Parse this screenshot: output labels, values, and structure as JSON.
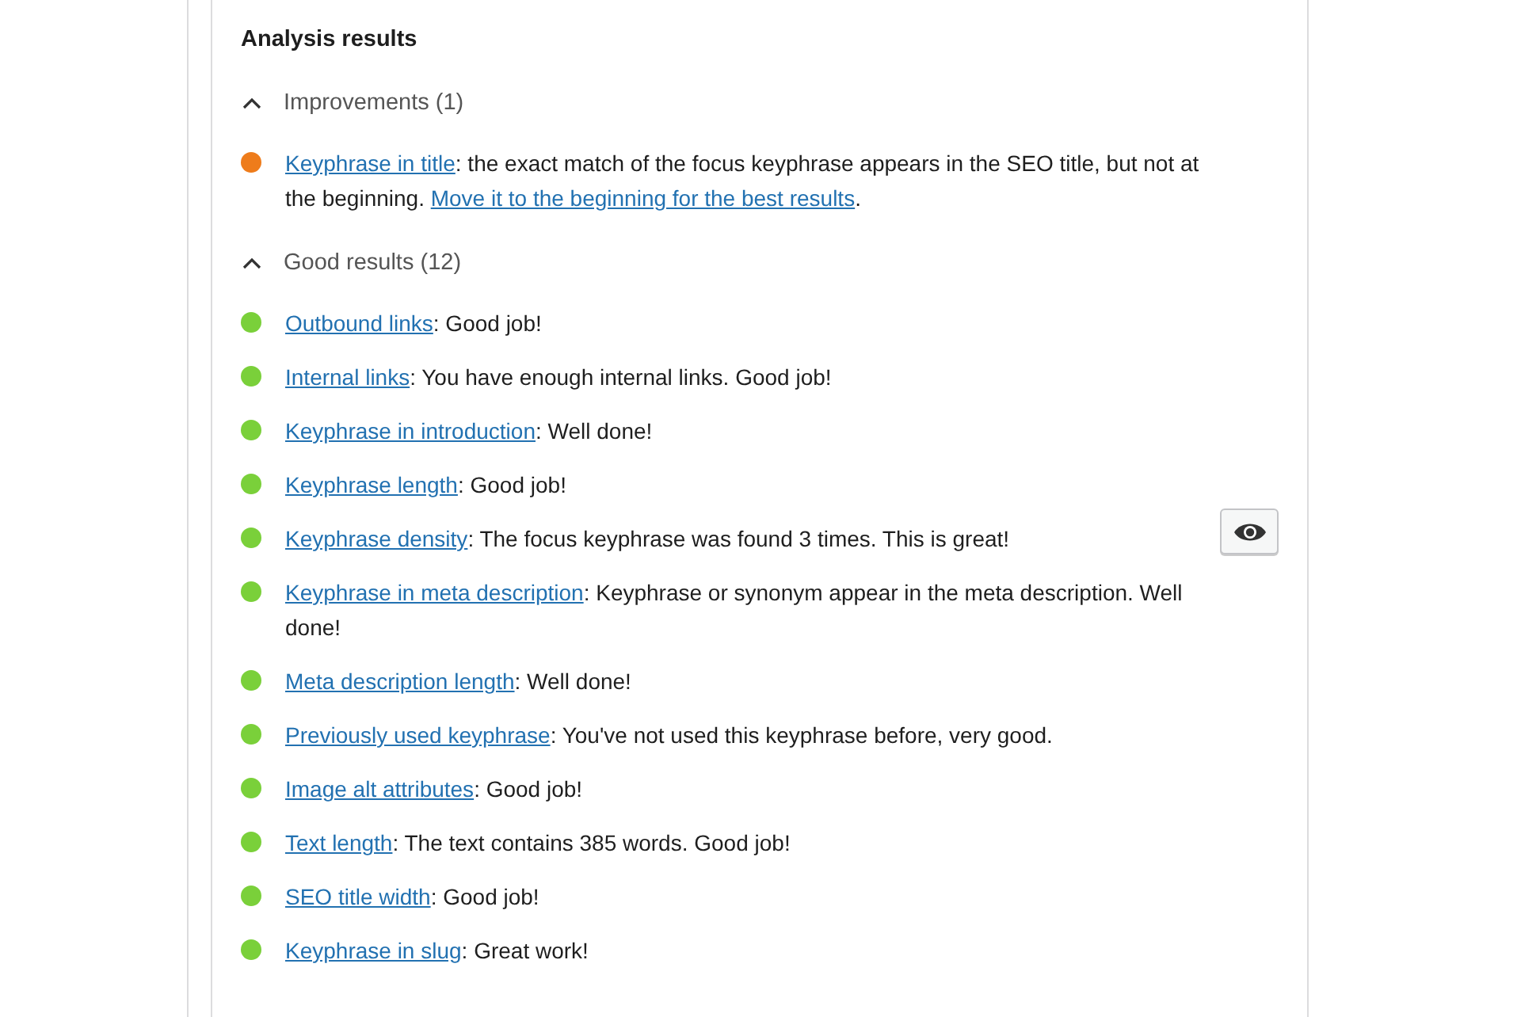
{
  "title": "Analysis results",
  "sections": [
    {
      "heading": "Improvements (1)",
      "expanded": true,
      "items": [
        {
          "color": "#ee7c1b",
          "highlight_button": false,
          "parts": [
            {
              "text": "Keyphrase in title",
              "link": true
            },
            {
              "text": ": the exact match of the focus keyphrase appears in the SEO title, but not at the beginning. ",
              "link": false
            },
            {
              "text": "Move it to the beginning for the best results",
              "link": true
            },
            {
              "text": ".",
              "link": false
            }
          ]
        }
      ]
    },
    {
      "heading": "Good results (12)",
      "expanded": true,
      "items": [
        {
          "color": "#7ad03a",
          "highlight_button": false,
          "parts": [
            {
              "text": "Outbound links",
              "link": true
            },
            {
              "text": ": Good job!",
              "link": false
            }
          ]
        },
        {
          "color": "#7ad03a",
          "highlight_button": false,
          "parts": [
            {
              "text": "Internal links",
              "link": true
            },
            {
              "text": ": You have enough internal links. Good job!",
              "link": false
            }
          ]
        },
        {
          "color": "#7ad03a",
          "highlight_button": false,
          "parts": [
            {
              "text": "Keyphrase in introduction",
              "link": true
            },
            {
              "text": ": Well done!",
              "link": false
            }
          ]
        },
        {
          "color": "#7ad03a",
          "highlight_button": false,
          "parts": [
            {
              "text": "Keyphrase length",
              "link": true
            },
            {
              "text": ": Good job!",
              "link": false
            }
          ]
        },
        {
          "color": "#7ad03a",
          "highlight_button": true,
          "parts": [
            {
              "text": "Keyphrase density",
              "link": true
            },
            {
              "text": ": The focus keyphrase was found 3 times. This is great!",
              "link": false
            }
          ]
        },
        {
          "color": "#7ad03a",
          "highlight_button": false,
          "parts": [
            {
              "text": "Keyphrase in meta description",
              "link": true
            },
            {
              "text": ": Keyphrase or synonym appear in the meta description. Well done!",
              "link": false
            }
          ]
        },
        {
          "color": "#7ad03a",
          "highlight_button": false,
          "parts": [
            {
              "text": "Meta description length",
              "link": true
            },
            {
              "text": ": Well done!",
              "link": false
            }
          ]
        },
        {
          "color": "#7ad03a",
          "highlight_button": false,
          "parts": [
            {
              "text": "Previously used keyphrase",
              "link": true
            },
            {
              "text": ": You've not used this keyphrase before, very good.",
              "link": false
            }
          ]
        },
        {
          "color": "#7ad03a",
          "highlight_button": false,
          "parts": [
            {
              "text": "Image alt attributes",
              "link": true
            },
            {
              "text": ": Good job!",
              "link": false
            }
          ]
        },
        {
          "color": "#7ad03a",
          "highlight_button": false,
          "parts": [
            {
              "text": "Text length",
              "link": true
            },
            {
              "text": ": The text contains 385 words. Good job!",
              "link": false
            }
          ]
        },
        {
          "color": "#7ad03a",
          "highlight_button": false,
          "parts": [
            {
              "text": "SEO title width",
              "link": true
            },
            {
              "text": ": Good job!",
              "link": false
            }
          ]
        },
        {
          "color": "#7ad03a",
          "highlight_button": false,
          "parts": [
            {
              "text": "Keyphrase in slug",
              "link": true
            },
            {
              "text": ": Great work!",
              "link": false
            }
          ]
        }
      ]
    }
  ]
}
